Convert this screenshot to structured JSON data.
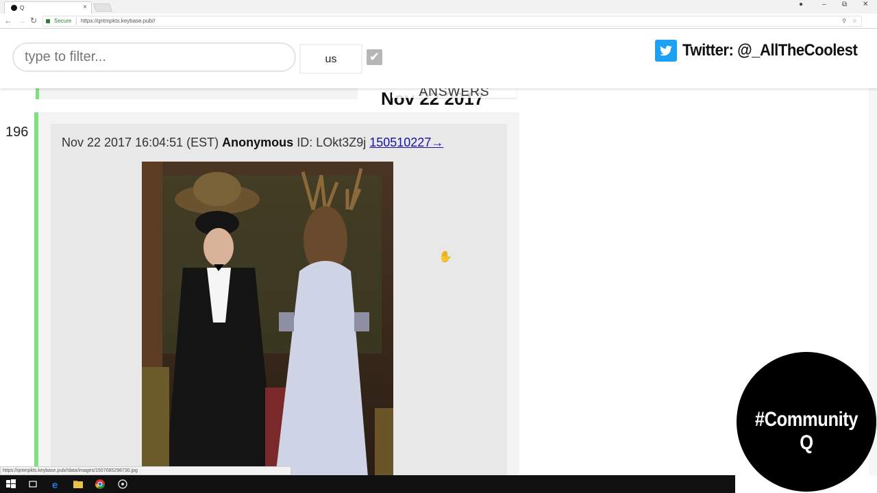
{
  "browser": {
    "tab_title": "Q",
    "secure_label": "Secure",
    "url": "https://qntmpkts.keybase.pub//",
    "status_url": "https://qntmpkts.keybase.pub//data/images/1507085298730.jpg"
  },
  "filter": {
    "placeholder": "type to filter...",
    "us_label": "us",
    "checkbox_checked": true
  },
  "twitter": {
    "handle": "Twitter: @_AllTheCoolest"
  },
  "ghost": {
    "answers": "ANSWERS",
    "date": "Nov 22 2017"
  },
  "post": {
    "number": "196",
    "timestamp": "Nov 22 2017 16:04:51 (EST)",
    "author": "Anonymous",
    "id_label": "ID: LOkt3Z9j",
    "link": "150510227→"
  },
  "overlay": {
    "community": "#Community Q"
  },
  "colors": {
    "accent_green": "#7fe07f",
    "link_blue": "#1a0dab",
    "twitter_blue": "#1da1f2"
  }
}
